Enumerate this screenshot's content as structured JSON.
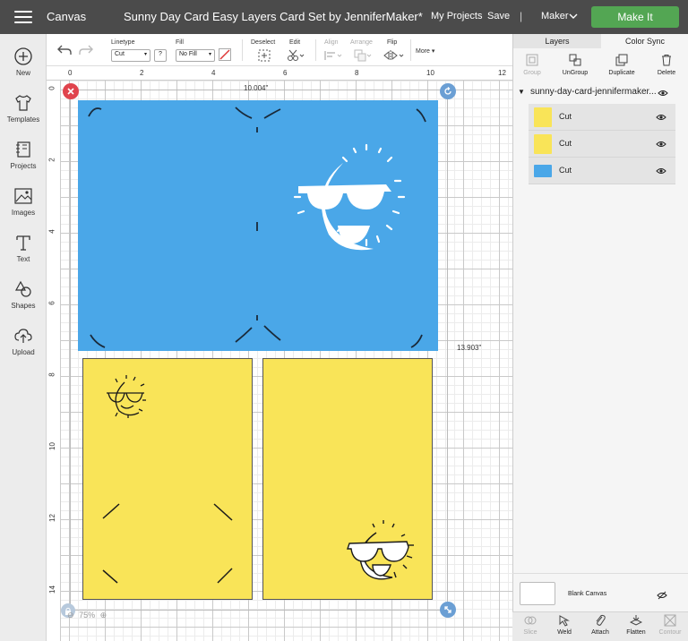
{
  "header": {
    "app_title": "Canvas",
    "doc_title": "Sunny Day Card Easy Layers Card Set by JenniferMaker*",
    "my_projects": "My Projects",
    "save": "Save",
    "divider": "|",
    "machine": "Maker",
    "make_it": "Make It"
  },
  "left_toolbar": [
    {
      "label": "New",
      "icon": "plus-circle-icon"
    },
    {
      "label": "Templates",
      "icon": "tshirt-icon"
    },
    {
      "label": "Projects",
      "icon": "projects-icon"
    },
    {
      "label": "Images",
      "icon": "image-icon"
    },
    {
      "label": "Text",
      "icon": "text-icon"
    },
    {
      "label": "Shapes",
      "icon": "shapes-icon"
    },
    {
      "label": "Upload",
      "icon": "upload-icon"
    }
  ],
  "edit_toolbar": {
    "linetype_label": "Linetype",
    "linetype_value": "Cut",
    "help": "?",
    "fill_label": "Fill",
    "fill_value": "No Fill",
    "deselect_label": "Deselect",
    "edit_label": "Edit",
    "align_label": "Align",
    "arrange_label": "Arrange",
    "flip_label": "Flip",
    "more_label": "More ▾"
  },
  "ruler": {
    "top": [
      "0",
      "2",
      "4",
      "6",
      "8",
      "10",
      "12"
    ],
    "left": [
      "0",
      "2",
      "4",
      "6",
      "8",
      "10",
      "12",
      "14"
    ]
  },
  "canvas": {
    "width_dim": "10.004\"",
    "height_dim": "13.903\"",
    "zoom": "75%",
    "colors": {
      "blue": "#4aa7e8",
      "yellow": "#f9e458",
      "delete_handle": "#e0444d",
      "rotate_handle": "#6b9fd4"
    }
  },
  "layers_panel": {
    "tabs": [
      "Layers",
      "Color Sync"
    ],
    "actions": [
      "Group",
      "UnGroup",
      "Duplicate",
      "Delete"
    ],
    "group_name": "sunny-day-card-jennifermaker...",
    "layers": [
      {
        "label": "Cut",
        "color": "#f9e458"
      },
      {
        "label": "Cut",
        "color": "#f9e458"
      },
      {
        "label": "Cut",
        "color": "#4aa7e8"
      }
    ],
    "blank_canvas": "Blank Canvas",
    "bottom_tools": [
      "Slice",
      "Weld",
      "Attach",
      "Flatten",
      "Contour"
    ]
  }
}
